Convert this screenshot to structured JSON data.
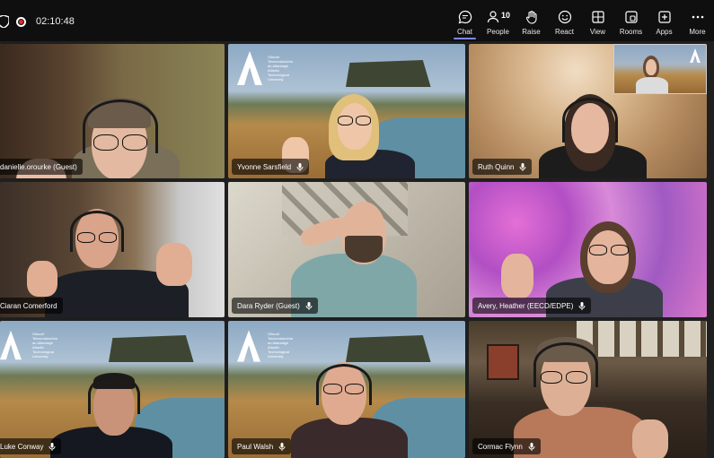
{
  "meeting": {
    "timer": "02:10:48"
  },
  "toolbar": {
    "people_count": "10",
    "items": [
      {
        "label": "Chat",
        "icon": "chat-icon"
      },
      {
        "label": "People",
        "icon": "people-icon"
      },
      {
        "label": "Raise",
        "icon": "raise-hand-icon"
      },
      {
        "label": "React",
        "icon": "react-icon"
      },
      {
        "label": "View",
        "icon": "view-icon"
      },
      {
        "label": "Rooms",
        "icon": "rooms-icon"
      },
      {
        "label": "Apps",
        "icon": "apps-icon"
      },
      {
        "label": "More",
        "icon": "more-icon"
      }
    ]
  },
  "background_logo": {
    "lines": [
      "Ollscoil",
      "Teicneolaíochta",
      "an Atlantaigh",
      "Atlantic",
      "Technological",
      "University"
    ]
  },
  "participants": [
    {
      "name": "danielle.orourke (Guest)",
      "mic": "mic-icon"
    },
    {
      "name": "Yvonne Sarsfield",
      "mic": "mic-icon"
    },
    {
      "name": "Ruth Quinn",
      "mic": "mic-icon"
    },
    {
      "name": "Ciaran Comerford",
      "mic": "mic-icon"
    },
    {
      "name": "Dara Ryder (Guest)",
      "mic": "mic-icon"
    },
    {
      "name": "Avery, Heather (EECD/EDPE)",
      "mic": "mic-icon"
    },
    {
      "name": "Luke Conway",
      "mic": "mic-icon"
    },
    {
      "name": "Paul Walsh",
      "mic": "mic-icon"
    },
    {
      "name": "Cormac Flynn",
      "mic": "mic-icon"
    }
  ],
  "colors": {
    "accent": "#7f85f5",
    "speaking_outline": "#8f8ff5",
    "record": "#e02d2d"
  }
}
